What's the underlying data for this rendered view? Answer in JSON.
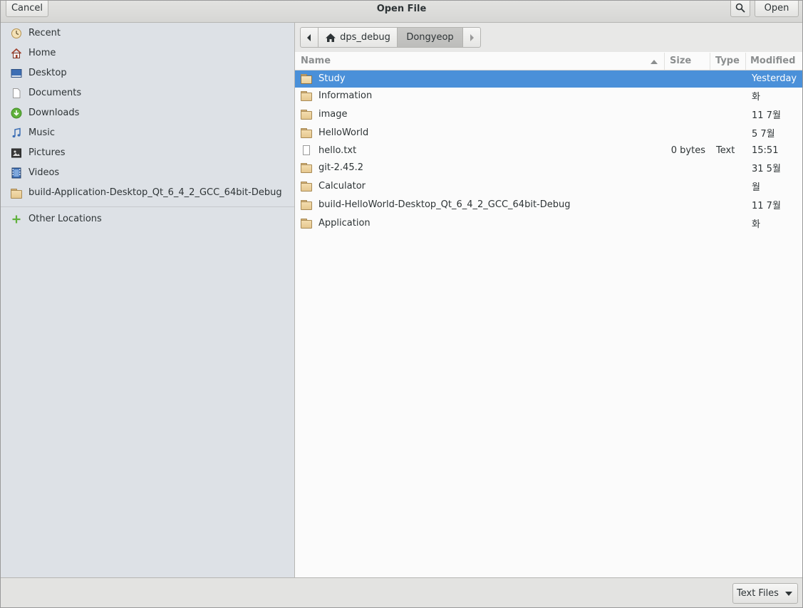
{
  "window": {
    "title": "Open File"
  },
  "header": {
    "cancel_label": "Cancel",
    "open_label": "Open",
    "search_icon": "search-icon"
  },
  "sidebar": {
    "items": [
      {
        "label": "Recent",
        "icon": "recent-icon"
      },
      {
        "label": "Home",
        "icon": "home-icon"
      },
      {
        "label": "Desktop",
        "icon": "desktop-icon"
      },
      {
        "label": "Documents",
        "icon": "documents-icon"
      },
      {
        "label": "Downloads",
        "icon": "downloads-icon"
      },
      {
        "label": "Music",
        "icon": "music-icon"
      },
      {
        "label": "Pictures",
        "icon": "pictures-icon"
      },
      {
        "label": "Videos",
        "icon": "videos-icon"
      },
      {
        "label": "build-Application-Desktop_Qt_6_4_2_GCC_64bit-Debug",
        "icon": "folder-icon"
      }
    ],
    "other": {
      "label": "Other Locations",
      "icon": "plus-icon"
    }
  },
  "pathbar": {
    "segments": [
      {
        "label": "dps_debug",
        "icon": "home-icon"
      },
      {
        "label": "Dongyeop"
      }
    ]
  },
  "columns": {
    "name": "Name",
    "size": "Size",
    "type": "Type",
    "modified": "Modified"
  },
  "files": [
    {
      "name": "Study",
      "size": "",
      "type": "",
      "modified": "Yesterday",
      "kind": "folder",
      "selected": true
    },
    {
      "name": "Information",
      "size": "",
      "type": "",
      "modified": "화",
      "kind": "folder"
    },
    {
      "name": "image",
      "size": "",
      "type": "",
      "modified": "11  7월",
      "kind": "folder"
    },
    {
      "name": "HelloWorld",
      "size": "",
      "type": "",
      "modified": "5  7월",
      "kind": "folder"
    },
    {
      "name": "hello.txt",
      "size": "0 bytes",
      "type": "Text",
      "modified": "15:51",
      "kind": "file"
    },
    {
      "name": "git-2.45.2",
      "size": "",
      "type": "",
      "modified": "31  5월",
      "kind": "folder"
    },
    {
      "name": "Calculator",
      "size": "",
      "type": "",
      "modified": "월",
      "kind": "folder"
    },
    {
      "name": "build-HelloWorld-Desktop_Qt_6_4_2_GCC_64bit-Debug",
      "size": "",
      "type": "",
      "modified": "11  7월",
      "kind": "folder"
    },
    {
      "name": "Application",
      "size": "",
      "type": "",
      "modified": "화",
      "kind": "folder"
    }
  ],
  "filter": {
    "label": "Text Files"
  },
  "colors": {
    "selection": "#4a90d9",
    "sidebar_bg": "#dde1e6"
  }
}
